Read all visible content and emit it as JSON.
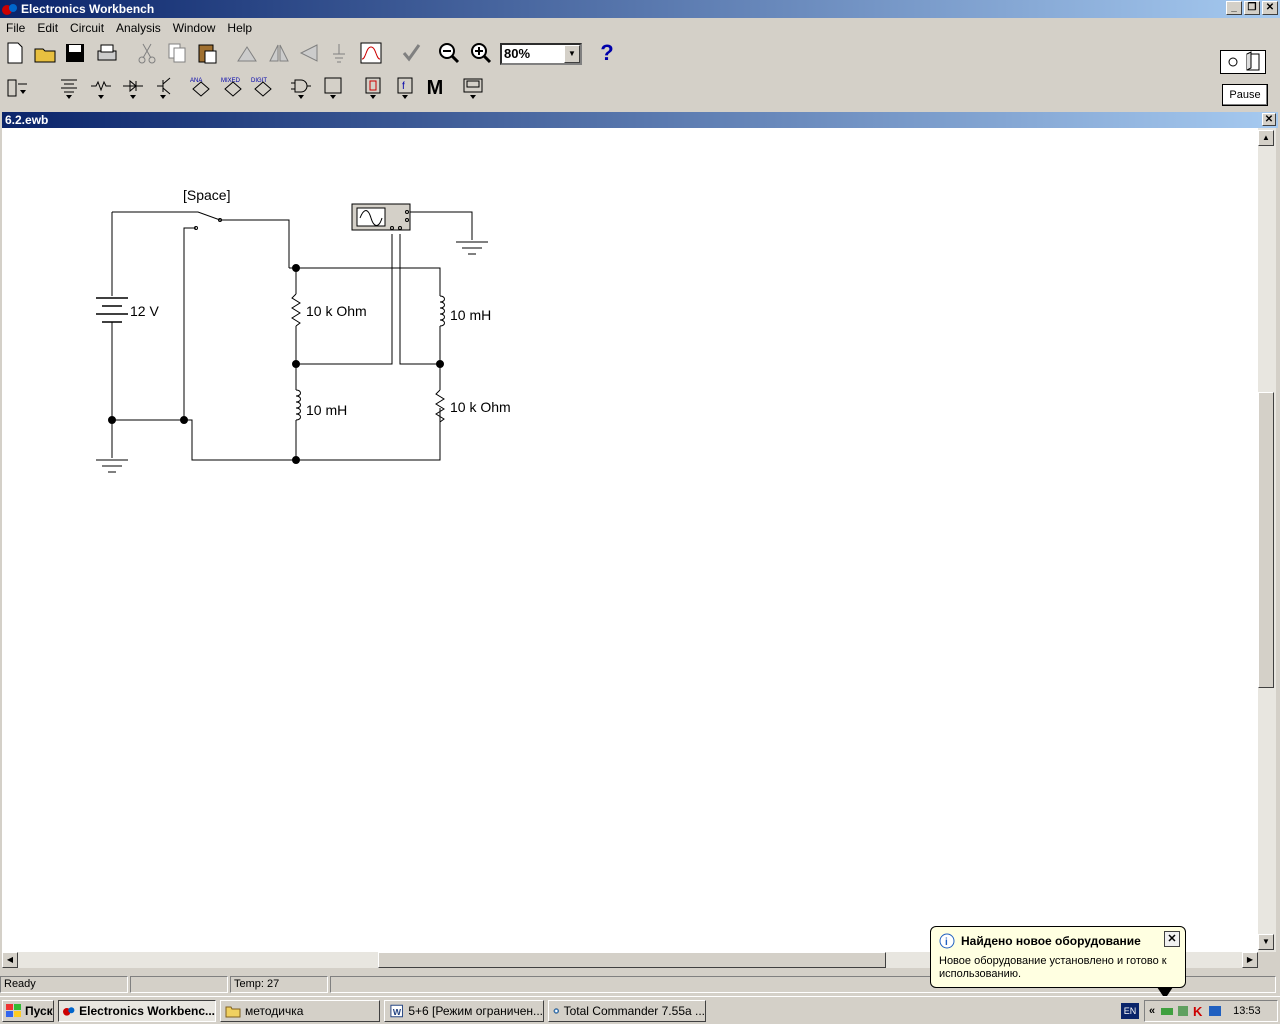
{
  "window": {
    "title": "Electronics Workbench"
  },
  "menu": [
    "File",
    "Edit",
    "Circuit",
    "Analysis",
    "Window",
    "Help"
  ],
  "toolbar": {
    "zoom_value": "80%",
    "help_label": "?",
    "pause_label": "Pause",
    "parts_labels": {
      "ana": "ANA",
      "mixed": "MIXED",
      "digit": "DIGIT",
      "misc": "M"
    }
  },
  "document": {
    "title": "6.2.ewb"
  },
  "circuit": {
    "switch_label": "[Space]",
    "battery_label": "12 V",
    "r1_label": "10 k Ohm",
    "l1_label": "10 mH",
    "l2_label": "10 mH",
    "r2_label": "10 k Ohm"
  },
  "status": {
    "ready": "Ready",
    "temp": "Temp:  27"
  },
  "balloon": {
    "title": "Найдено новое оборудование",
    "body": "Новое оборудование установлено и готово к использованию.",
    "close": "✕"
  },
  "taskbar": {
    "start": "Пуск",
    "tasks": [
      {
        "label": "Electronics Workbenc..."
      },
      {
        "label": "методичка"
      },
      {
        "label": "5+6 [Режим ограничен..."
      },
      {
        "label": "Total Commander 7.55a ..."
      }
    ],
    "expand": "«",
    "lang": "EN",
    "clock": "13:53"
  }
}
